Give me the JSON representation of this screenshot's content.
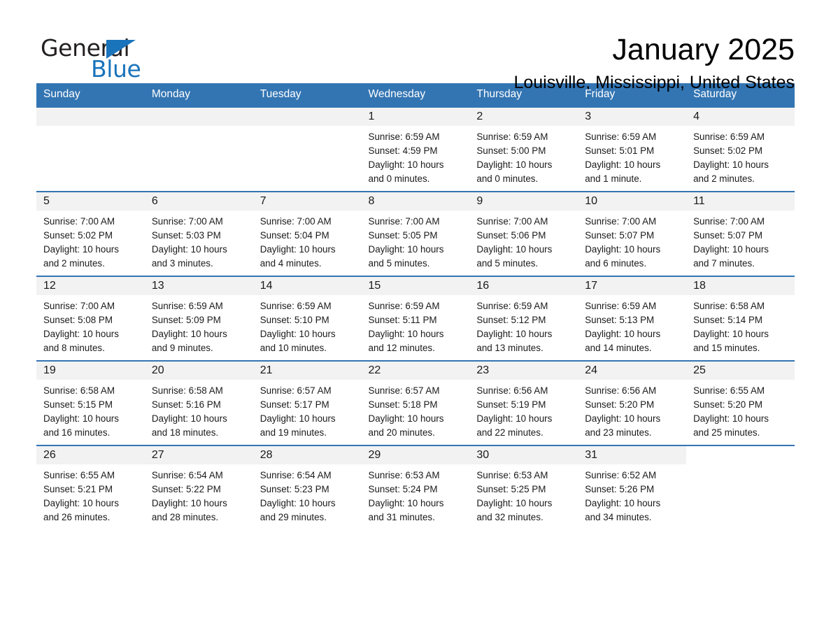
{
  "brand": {
    "name_part1": "General",
    "name_part2": "Blue",
    "accent_color": "#1a74bb"
  },
  "header": {
    "month_title": "January 2025",
    "location": "Louisville, Mississippi, United States",
    "header_bg_color": "#3375b3",
    "row_divider_color": "#3375b3",
    "daynum_band_color": "#f2f2f2"
  },
  "weekday_headers": [
    "Sunday",
    "Monday",
    "Tuesday",
    "Wednesday",
    "Thursday",
    "Friday",
    "Saturday"
  ],
  "weeks": [
    [
      {
        "day": "",
        "empty": true
      },
      {
        "day": "",
        "empty": true
      },
      {
        "day": "",
        "empty": true
      },
      {
        "day": "1",
        "sunrise": "Sunrise: 6:59 AM",
        "sunset": "Sunset: 4:59 PM",
        "daylight_line1": "Daylight: 10 hours",
        "daylight_line2": "and 0 minutes."
      },
      {
        "day": "2",
        "sunrise": "Sunrise: 6:59 AM",
        "sunset": "Sunset: 5:00 PM",
        "daylight_line1": "Daylight: 10 hours",
        "daylight_line2": "and 0 minutes."
      },
      {
        "day": "3",
        "sunrise": "Sunrise: 6:59 AM",
        "sunset": "Sunset: 5:01 PM",
        "daylight_line1": "Daylight: 10 hours",
        "daylight_line2": "and 1 minute."
      },
      {
        "day": "4",
        "sunrise": "Sunrise: 6:59 AM",
        "sunset": "Sunset: 5:02 PM",
        "daylight_line1": "Daylight: 10 hours",
        "daylight_line2": "and 2 minutes."
      }
    ],
    [
      {
        "day": "5",
        "sunrise": "Sunrise: 7:00 AM",
        "sunset": "Sunset: 5:02 PM",
        "daylight_line1": "Daylight: 10 hours",
        "daylight_line2": "and 2 minutes."
      },
      {
        "day": "6",
        "sunrise": "Sunrise: 7:00 AM",
        "sunset": "Sunset: 5:03 PM",
        "daylight_line1": "Daylight: 10 hours",
        "daylight_line2": "and 3 minutes."
      },
      {
        "day": "7",
        "sunrise": "Sunrise: 7:00 AM",
        "sunset": "Sunset: 5:04 PM",
        "daylight_line1": "Daylight: 10 hours",
        "daylight_line2": "and 4 minutes."
      },
      {
        "day": "8",
        "sunrise": "Sunrise: 7:00 AM",
        "sunset": "Sunset: 5:05 PM",
        "daylight_line1": "Daylight: 10 hours",
        "daylight_line2": "and 5 minutes."
      },
      {
        "day": "9",
        "sunrise": "Sunrise: 7:00 AM",
        "sunset": "Sunset: 5:06 PM",
        "daylight_line1": "Daylight: 10 hours",
        "daylight_line2": "and 5 minutes."
      },
      {
        "day": "10",
        "sunrise": "Sunrise: 7:00 AM",
        "sunset": "Sunset: 5:07 PM",
        "daylight_line1": "Daylight: 10 hours",
        "daylight_line2": "and 6 minutes."
      },
      {
        "day": "11",
        "sunrise": "Sunrise: 7:00 AM",
        "sunset": "Sunset: 5:07 PM",
        "daylight_line1": "Daylight: 10 hours",
        "daylight_line2": "and 7 minutes."
      }
    ],
    [
      {
        "day": "12",
        "sunrise": "Sunrise: 7:00 AM",
        "sunset": "Sunset: 5:08 PM",
        "daylight_line1": "Daylight: 10 hours",
        "daylight_line2": "and 8 minutes."
      },
      {
        "day": "13",
        "sunrise": "Sunrise: 6:59 AM",
        "sunset": "Sunset: 5:09 PM",
        "daylight_line1": "Daylight: 10 hours",
        "daylight_line2": "and 9 minutes."
      },
      {
        "day": "14",
        "sunrise": "Sunrise: 6:59 AM",
        "sunset": "Sunset: 5:10 PM",
        "daylight_line1": "Daylight: 10 hours",
        "daylight_line2": "and 10 minutes."
      },
      {
        "day": "15",
        "sunrise": "Sunrise: 6:59 AM",
        "sunset": "Sunset: 5:11 PM",
        "daylight_line1": "Daylight: 10 hours",
        "daylight_line2": "and 12 minutes."
      },
      {
        "day": "16",
        "sunrise": "Sunrise: 6:59 AM",
        "sunset": "Sunset: 5:12 PM",
        "daylight_line1": "Daylight: 10 hours",
        "daylight_line2": "and 13 minutes."
      },
      {
        "day": "17",
        "sunrise": "Sunrise: 6:59 AM",
        "sunset": "Sunset: 5:13 PM",
        "daylight_line1": "Daylight: 10 hours",
        "daylight_line2": "and 14 minutes."
      },
      {
        "day": "18",
        "sunrise": "Sunrise: 6:58 AM",
        "sunset": "Sunset: 5:14 PM",
        "daylight_line1": "Daylight: 10 hours",
        "daylight_line2": "and 15 minutes."
      }
    ],
    [
      {
        "day": "19",
        "sunrise": "Sunrise: 6:58 AM",
        "sunset": "Sunset: 5:15 PM",
        "daylight_line1": "Daylight: 10 hours",
        "daylight_line2": "and 16 minutes."
      },
      {
        "day": "20",
        "sunrise": "Sunrise: 6:58 AM",
        "sunset": "Sunset: 5:16 PM",
        "daylight_line1": "Daylight: 10 hours",
        "daylight_line2": "and 18 minutes."
      },
      {
        "day": "21",
        "sunrise": "Sunrise: 6:57 AM",
        "sunset": "Sunset: 5:17 PM",
        "daylight_line1": "Daylight: 10 hours",
        "daylight_line2": "and 19 minutes."
      },
      {
        "day": "22",
        "sunrise": "Sunrise: 6:57 AM",
        "sunset": "Sunset: 5:18 PM",
        "daylight_line1": "Daylight: 10 hours",
        "daylight_line2": "and 20 minutes."
      },
      {
        "day": "23",
        "sunrise": "Sunrise: 6:56 AM",
        "sunset": "Sunset: 5:19 PM",
        "daylight_line1": "Daylight: 10 hours",
        "daylight_line2": "and 22 minutes."
      },
      {
        "day": "24",
        "sunrise": "Sunrise: 6:56 AM",
        "sunset": "Sunset: 5:20 PM",
        "daylight_line1": "Daylight: 10 hours",
        "daylight_line2": "and 23 minutes."
      },
      {
        "day": "25",
        "sunrise": "Sunrise: 6:55 AM",
        "sunset": "Sunset: 5:20 PM",
        "daylight_line1": "Daylight: 10 hours",
        "daylight_line2": "and 25 minutes."
      }
    ],
    [
      {
        "day": "26",
        "sunrise": "Sunrise: 6:55 AM",
        "sunset": "Sunset: 5:21 PM",
        "daylight_line1": "Daylight: 10 hours",
        "daylight_line2": "and 26 minutes."
      },
      {
        "day": "27",
        "sunrise": "Sunrise: 6:54 AM",
        "sunset": "Sunset: 5:22 PM",
        "daylight_line1": "Daylight: 10 hours",
        "daylight_line2": "and 28 minutes."
      },
      {
        "day": "28",
        "sunrise": "Sunrise: 6:54 AM",
        "sunset": "Sunset: 5:23 PM",
        "daylight_line1": "Daylight: 10 hours",
        "daylight_line2": "and 29 minutes."
      },
      {
        "day": "29",
        "sunrise": "Sunrise: 6:53 AM",
        "sunset": "Sunset: 5:24 PM",
        "daylight_line1": "Daylight: 10 hours",
        "daylight_line2": "and 31 minutes."
      },
      {
        "day": "30",
        "sunrise": "Sunrise: 6:53 AM",
        "sunset": "Sunset: 5:25 PM",
        "daylight_line1": "Daylight: 10 hours",
        "daylight_line2": "and 32 minutes."
      },
      {
        "day": "31",
        "sunrise": "Sunrise: 6:52 AM",
        "sunset": "Sunset: 5:26 PM",
        "daylight_line1": "Daylight: 10 hours",
        "daylight_line2": "and 34 minutes."
      },
      {
        "day": "",
        "empty": true,
        "trailing": true
      }
    ]
  ]
}
